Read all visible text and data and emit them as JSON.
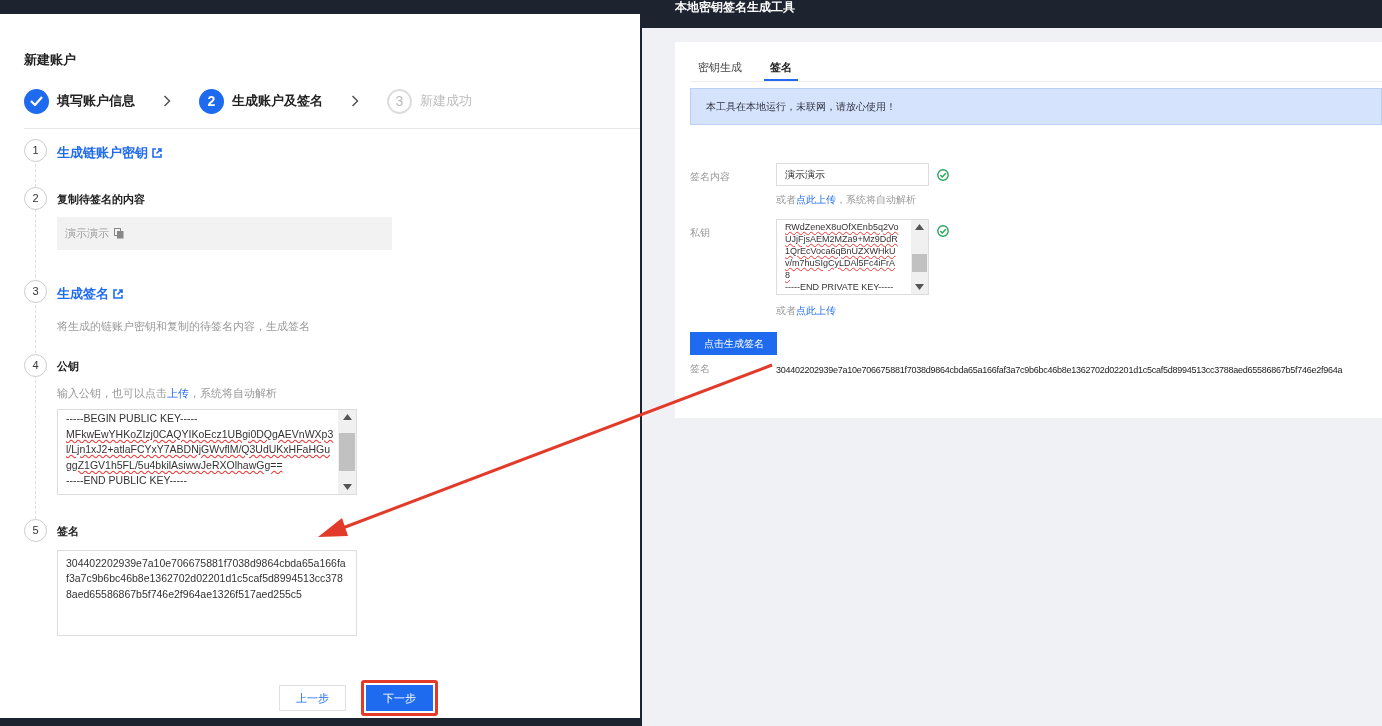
{
  "left_panel": {
    "title": "新建账户",
    "steps": [
      {
        "label": "填写账户信息",
        "done": true,
        "selected": false
      },
      {
        "label": "生成账户及签名",
        "number": "2",
        "done": false,
        "selected": true
      },
      {
        "label": "新建成功",
        "number": "3",
        "done": false,
        "selected": false
      }
    ],
    "sections": [
      {
        "number": "1",
        "kind": "link",
        "title": "生成链账户密钥"
      },
      {
        "number": "2",
        "kind": "copy",
        "title": "复制待签名的内容",
        "value": "演示演示"
      },
      {
        "number": "3",
        "kind": "link",
        "title": "生成签名",
        "hint": "将生成的链账户密钥和复制的待签名内容，生成签名"
      },
      {
        "number": "4",
        "kind": "key",
        "title": "公钥",
        "hint_before": "输入公钥，也可以点击",
        "hint_link": "上传",
        "hint_after": "，系统将自动解析",
        "lines": [
          "-----BEGIN PUBLIC KEY-----",
          "MFkwEwYHKoZIzj0CAQYIKoEcz1UBgi0DQgAEVnWXp3",
          "l/Ljn1xJ2+atlaFCYxY7ABDNjGWvflM/Q3UdUKxHFaHGu",
          "ggZ1GV1h5FL/5u4bkilAsiwwJeRXOlhawGg==",
          "-----END PUBLIC KEY-----"
        ]
      },
      {
        "number": "5",
        "kind": "signature",
        "title": "签名",
        "value": "304402202939e7a10e706675881f7038d9864cbda65a166faf3a7c9b6bc46b8e1362702d02201d1c5caf5d8994513cc3788aed65586867b5f746e2f964ae1326f517aed255c5"
      }
    ],
    "buttons": [
      {
        "label": "上一步",
        "primary": false,
        "highlighted": false
      },
      {
        "label": "下一步",
        "primary": true,
        "highlighted": true
      }
    ]
  },
  "right_panel": {
    "title": "本地密钥签名生成工具",
    "tabs": [
      {
        "label": "密钥生成",
        "selected": false
      },
      {
        "label": "签名",
        "selected": true
      }
    ],
    "notice": "本工具在本地运行，未联网，请放心使用！",
    "content_field": {
      "label": "签名内容",
      "value": "演示演示",
      "valid": true,
      "hint_before": "或者",
      "hint_link": "点此上传",
      "hint_after": "，系统将自动解析"
    },
    "private_key_field": {
      "label": "私钥",
      "lines": [
        "RWdZeneX8uOfXEnb5q2Vo",
        "UJjFjsAEM2MZa9+Mz9DdR",
        "1QrEcVoca6qBnUZXWHkU",
        "v/m7huSIgCyLDAl5Fc4iFrA",
        "8",
        "-----END PRIVATE KEY-----"
      ],
      "valid": true,
      "hint_before": "或者",
      "hint_link": "点此上传"
    },
    "generate_button": "点击生成签名",
    "signature": {
      "label": "签名",
      "value": "304402202939e7a10e706675881f7038d9864cbda65a166faf3a7c9b6bc46b8e1362702d02201d1c5caf5d8994513cc3788aed65586867b5f746e2f964a"
    }
  }
}
